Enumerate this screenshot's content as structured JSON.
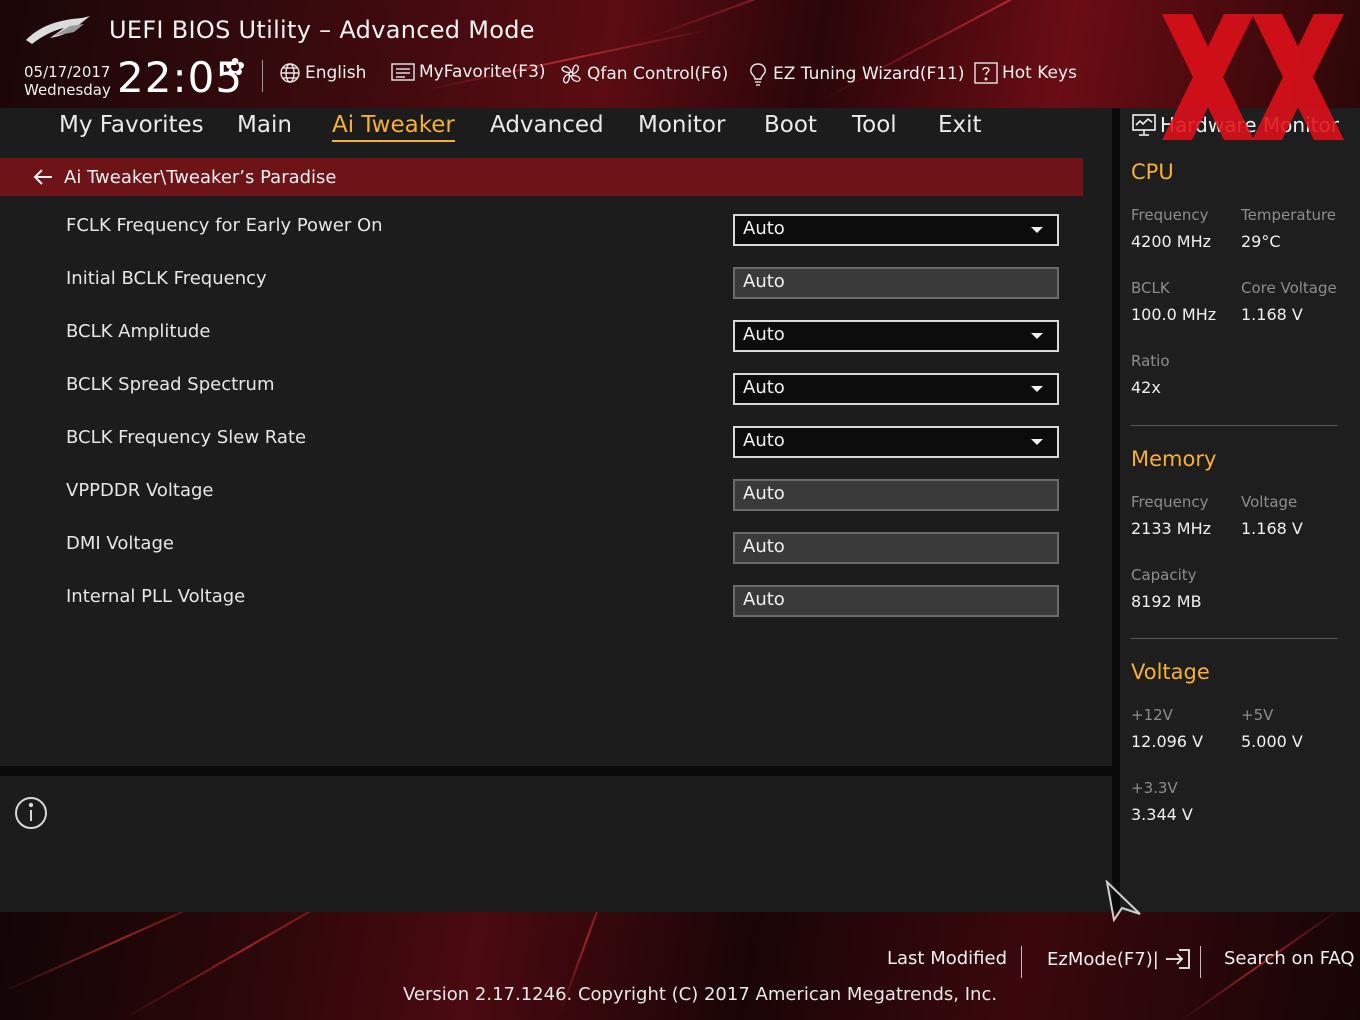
{
  "header": {
    "title": "UEFI BIOS Utility – Advanced Mode",
    "date": "05/17/2017",
    "weekday": "Wednesday",
    "time": "22:05",
    "language": "English",
    "myfavorite": "MyFavorite(F3)",
    "qfan": "Qfan Control(F6)",
    "ez_tuning": "EZ Tuning Wizard(F11)",
    "hot_keys": "Hot Keys"
  },
  "menu": {
    "tabs": [
      "My Favorites",
      "Main",
      "Ai Tweaker",
      "Advanced",
      "Monitor",
      "Boot",
      "Tool",
      "Exit"
    ],
    "active": "Ai Tweaker"
  },
  "breadcrumb": "Ai Tweaker\\Tweaker’s Paradise",
  "settings": [
    {
      "label": "FCLK Frequency for Early Power On",
      "value": "Auto",
      "type": "dropdown"
    },
    {
      "label": "Initial BCLK Frequency",
      "value": "Auto",
      "type": "text"
    },
    {
      "label": "BCLK Amplitude",
      "value": "Auto",
      "type": "dropdown"
    },
    {
      "label": "BCLK Spread Spectrum",
      "value": "Auto",
      "type": "dropdown"
    },
    {
      "label": "BCLK Frequency Slew Rate",
      "value": "Auto",
      "type": "dropdown"
    },
    {
      "label": "VPPDDR Voltage",
      "value": "Auto",
      "type": "text"
    },
    {
      "label": "DMI Voltage",
      "value": "Auto",
      "type": "text"
    },
    {
      "label": "Internal PLL Voltage",
      "value": "Auto",
      "type": "text"
    }
  ],
  "hw_monitor": {
    "title": "Hardware Monitor",
    "cpu": {
      "heading": "CPU",
      "frequency_label": "Frequency",
      "frequency": "4200 MHz",
      "temperature_label": "Temperature",
      "temperature": "29°C",
      "bclk_label": "BCLK",
      "bclk": "100.0 MHz",
      "core_voltage_label": "Core Voltage",
      "core_voltage": "1.168 V",
      "ratio_label": "Ratio",
      "ratio": "42x"
    },
    "memory": {
      "heading": "Memory",
      "frequency_label": "Frequency",
      "frequency": "2133 MHz",
      "voltage_label": "Voltage",
      "voltage": "1.168 V",
      "capacity_label": "Capacity",
      "capacity": "8192 MB"
    },
    "voltage": {
      "heading": "Voltage",
      "v12_label": "+12V",
      "v12": "12.096 V",
      "v5_label": "+5V",
      "v5": "5.000 V",
      "v33_label": "+3.3V",
      "v33": "3.344 V"
    }
  },
  "footer": {
    "last_modified": "Last Modified",
    "ezmode": "EzMode(F7)|",
    "search_faq": "Search on FAQ",
    "version": "Version 2.17.1246. Copyright (C) 2017 American Megatrends, Inc."
  },
  "colors": {
    "accent": "#f6b033",
    "breadcrumb_bg": "#6e1317",
    "watermark_red": "#e0101a"
  }
}
